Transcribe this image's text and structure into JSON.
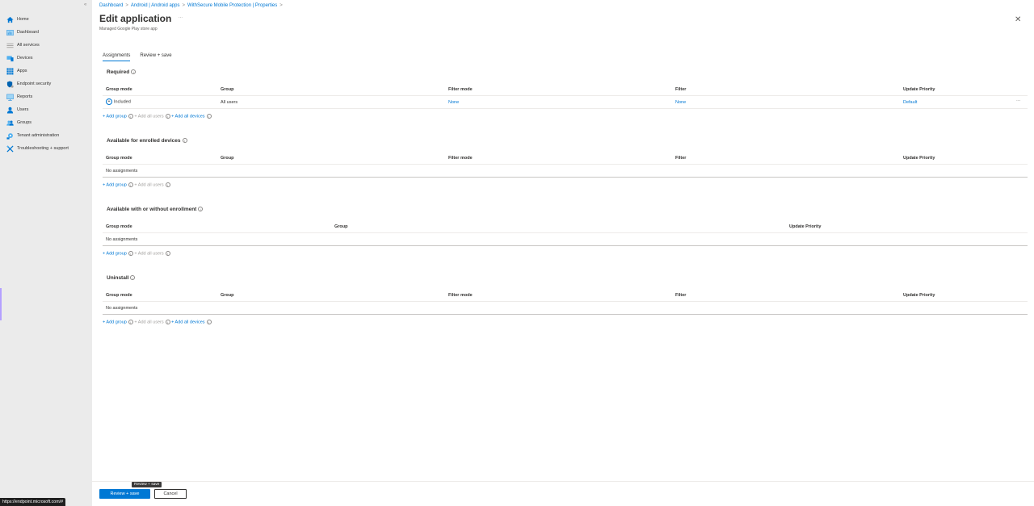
{
  "sidebar": {
    "collapse_icon": "«",
    "items": [
      {
        "label": "Home",
        "icon": "home-icon",
        "color": "#0078d4"
      },
      {
        "label": "Dashboard",
        "icon": "dashboard-icon",
        "color": "#3a96dd"
      },
      {
        "label": "All services",
        "icon": "all-services-icon",
        "color": "#8cbd18"
      },
      {
        "label": "Devices",
        "icon": "devices-icon",
        "color": "#0078d4"
      },
      {
        "label": "Apps",
        "icon": "apps-icon",
        "color": "#0078d4"
      },
      {
        "label": "Endpoint security",
        "icon": "endpoint-security-icon",
        "color": "#0063b1"
      },
      {
        "label": "Reports",
        "icon": "reports-icon",
        "color": "#3a96dd"
      },
      {
        "label": "Users",
        "icon": "users-icon",
        "color": "#0078d4"
      },
      {
        "label": "Groups",
        "icon": "groups-icon",
        "color": "#0078d4"
      },
      {
        "label": "Tenant administration",
        "icon": "tenant-admin-icon",
        "color": "#0078d4"
      },
      {
        "label": "Troubleshooting + support",
        "icon": "troubleshooting-icon",
        "color": "#0078d4"
      }
    ]
  },
  "status_url": "https://endpoint.microsoft.com/#",
  "header": {
    "breadcrumb": [
      "Dashboard",
      "Android | Android apps",
      "WithSecure Mobile Protection | Properties"
    ],
    "title": "Edit application",
    "more": "...",
    "subtitle": "Managed Google Play store app",
    "close": "✕"
  },
  "tabs": [
    {
      "label": "Assignments",
      "active": true
    },
    {
      "label": "Review + save",
      "active": false
    }
  ],
  "columns_full": [
    "Group mode",
    "Group",
    "Filter mode",
    "Filter",
    "Update Priority"
  ],
  "columns_short": [
    "Group mode",
    "Group",
    "Update Priority"
  ],
  "sections": {
    "required": {
      "title": "Required",
      "rows": [
        {
          "group_mode": "Included",
          "group": "All users",
          "filter_mode": "None",
          "filter": "None",
          "update_priority": "Default",
          "more": "···"
        }
      ],
      "actions": [
        "+ Add group",
        "+ Add all users",
        "+ Add all devices"
      ]
    },
    "enrolled": {
      "title": "Available for enrolled devices",
      "empty": "No assignments",
      "actions": [
        "+ Add group",
        "+ Add all users"
      ]
    },
    "with_without": {
      "title": "Available with or without enrollment",
      "empty": "No assignments",
      "actions": [
        "+ Add group",
        "+ Add all users"
      ]
    },
    "uninstall": {
      "title": "Uninstall",
      "empty": "No assignments",
      "actions": [
        "+ Add group",
        "+ Add all users",
        "+ Add all devices"
      ]
    }
  },
  "footer": {
    "primary": "Review + save",
    "secondary": "Cancel",
    "tooltip": "Review + save"
  }
}
